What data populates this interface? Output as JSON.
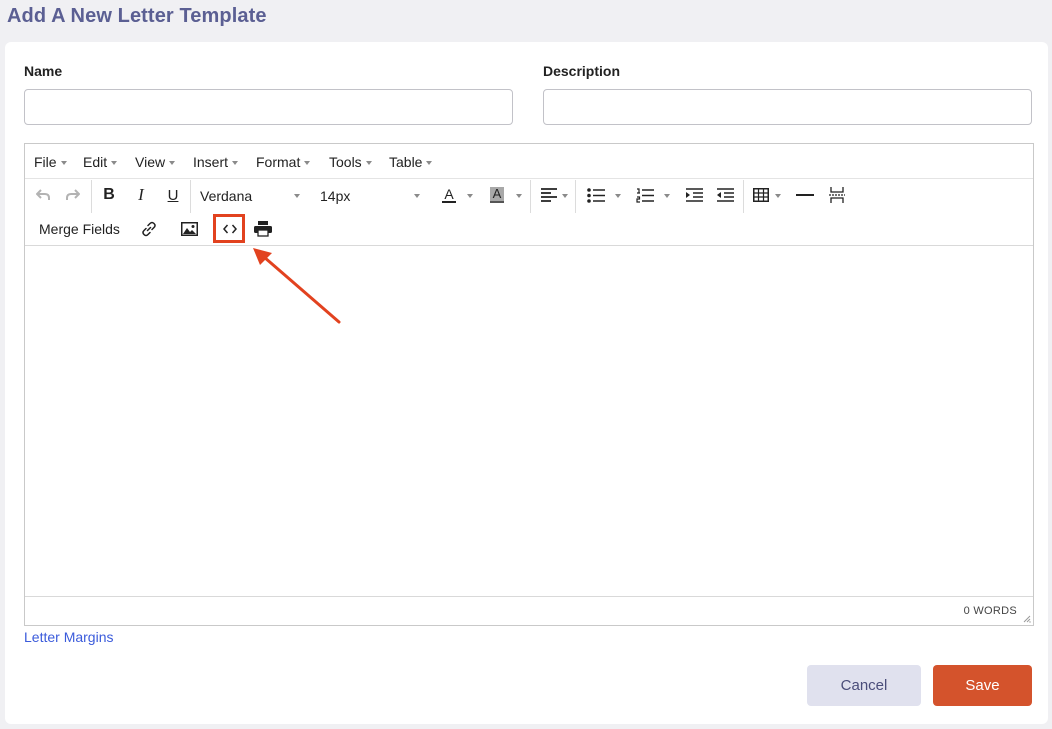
{
  "page": {
    "title": "Add A New Letter Template"
  },
  "form": {
    "name_label": "Name",
    "name_value": "",
    "description_label": "Description",
    "description_value": ""
  },
  "editor": {
    "menu": [
      "File",
      "Edit",
      "View",
      "Insert",
      "Format",
      "Tools",
      "Table"
    ],
    "font_family": "Verdana",
    "font_size": "14px",
    "text_color_glyph": "A",
    "bg_color_glyph": "A",
    "merge_fields_label": "Merge Fields",
    "word_count": "0 WORDS",
    "content": ""
  },
  "links": {
    "letter_margins": "Letter Margins"
  },
  "actions": {
    "cancel_label": "Cancel",
    "save_label": "Save"
  },
  "colors": {
    "title": "#5b5f93",
    "save_button": "#d4532c",
    "cancel_button": "#e0e1ee",
    "annotation": "#e2421f",
    "link": "#3b5bdb"
  },
  "icons": {
    "undo": "undo-icon",
    "redo": "redo-icon",
    "bold": "bold-icon",
    "italic": "italic-icon",
    "underline": "underline-icon",
    "align": "align-left-icon",
    "bullet_list": "bullet-list-icon",
    "numbered_list": "numbered-list-icon",
    "indent": "indent-icon",
    "outdent": "outdent-icon",
    "table": "table-icon",
    "hr": "horizontal-rule-icon",
    "page_break": "page-break-icon",
    "link": "link-icon",
    "image": "image-icon",
    "source_code": "source-code-icon",
    "print": "print-icon"
  }
}
